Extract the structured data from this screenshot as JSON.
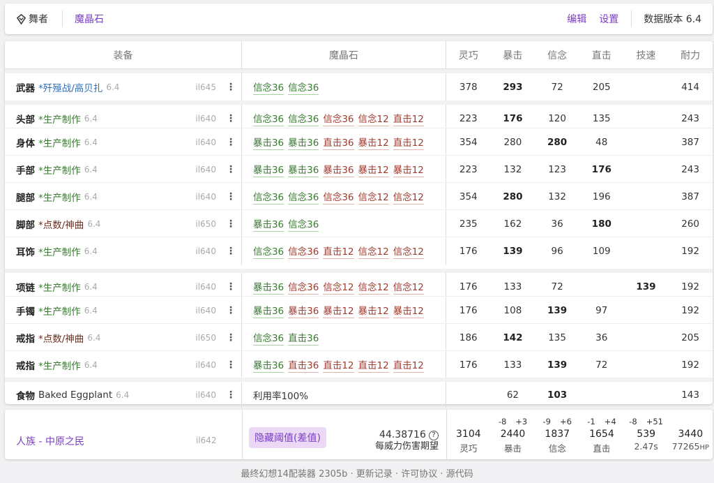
{
  "topbar": {
    "job": "舞者",
    "tab": "魔晶石",
    "edit": "编辑",
    "settings": "设置",
    "version": "数据版本 6.4"
  },
  "table": {
    "headers": {
      "equip": "装备",
      "materia": "魔晶石",
      "stats": [
        "灵巧",
        "暴击",
        "信念",
        "直击",
        "技速",
        "耐力"
      ]
    },
    "rows": [
      {
        "slot": "武器",
        "item": "*歼殛战/高贝扎",
        "type": "raid",
        "patch": "6.4",
        "ilvl": "il645",
        "materia": [
          {
            "t": "信念36",
            "s": "hl"
          },
          {
            "t": "信念36",
            "s": "hl"
          }
        ],
        "stats": [
          "378",
          "293",
          "72",
          "205",
          "",
          "414"
        ],
        "bold": [
          1
        ]
      },
      {
        "slot": "头部",
        "item": "*生产制作",
        "type": "craft",
        "patch": "6.4",
        "ilvl": "il640",
        "materia": [
          {
            "t": "信念36",
            "s": "hl"
          },
          {
            "t": "信念36",
            "s": "hl"
          },
          {
            "t": "信念36",
            "s": "bad"
          },
          {
            "t": "信念12",
            "s": "bad"
          },
          {
            "t": "直击12",
            "s": "bad"
          }
        ],
        "stats": [
          "223",
          "176",
          "120",
          "135",
          "",
          "243"
        ],
        "bold": [
          1
        ]
      },
      {
        "slot": "身体",
        "item": "*生产制作",
        "type": "craft",
        "patch": "6.4",
        "ilvl": "il640",
        "materia": [
          {
            "t": "暴击36",
            "s": "hl"
          },
          {
            "t": "暴击36",
            "s": "hl"
          },
          {
            "t": "直击36",
            "s": "bad"
          },
          {
            "t": "暴击12",
            "s": "bad"
          },
          {
            "t": "直击12",
            "s": "bad"
          }
        ],
        "stats": [
          "354",
          "280",
          "280",
          "48",
          "",
          "387"
        ],
        "bold": [
          2
        ]
      },
      {
        "slot": "手部",
        "item": "*生产制作",
        "type": "craft",
        "patch": "6.4",
        "ilvl": "il640",
        "materia": [
          {
            "t": "暴击36",
            "s": "hl"
          },
          {
            "t": "暴击36",
            "s": "hl"
          },
          {
            "t": "暴击36",
            "s": "bad"
          },
          {
            "t": "暴击12",
            "s": "bad"
          },
          {
            "t": "暴击12",
            "s": "bad"
          }
        ],
        "stats": [
          "223",
          "132",
          "123",
          "176",
          "",
          "243"
        ],
        "bold": [
          3
        ]
      },
      {
        "slot": "腿部",
        "item": "*生产制作",
        "type": "craft",
        "patch": "6.4",
        "ilvl": "il640",
        "materia": [
          {
            "t": "信念36",
            "s": "hl"
          },
          {
            "t": "信念36",
            "s": "hl"
          },
          {
            "t": "信念36",
            "s": "bad"
          },
          {
            "t": "信念12",
            "s": "bad"
          },
          {
            "t": "信念12",
            "s": "bad"
          }
        ],
        "stats": [
          "354",
          "280",
          "132",
          "196",
          "",
          "387"
        ],
        "bold": [
          1
        ]
      },
      {
        "slot": "脚部",
        "item": "*点数/神曲",
        "type": "tome",
        "patch": "6.4",
        "ilvl": "il650",
        "materia": [
          {
            "t": "暴击36",
            "s": "hl"
          },
          {
            "t": "信念36",
            "s": "hl"
          }
        ],
        "stats": [
          "235",
          "162",
          "36",
          "180",
          "",
          "260"
        ],
        "bold": [
          3
        ]
      },
      {
        "slot": "耳饰",
        "item": "*生产制作",
        "type": "craft",
        "patch": "6.4",
        "ilvl": "il640",
        "materia": [
          {
            "t": "信念36",
            "s": "hl"
          },
          {
            "t": "信念36",
            "s": "bad"
          },
          {
            "t": "直击12",
            "s": "bad"
          },
          {
            "t": "信念12",
            "s": "bad"
          },
          {
            "t": "信念12",
            "s": "bad"
          }
        ],
        "stats": [
          "176",
          "139",
          "96",
          "109",
          "",
          "192"
        ],
        "bold": [
          1
        ]
      },
      {
        "slot": "项链",
        "item": "*生产制作",
        "type": "craft",
        "patch": "6.4",
        "ilvl": "il640",
        "materia": [
          {
            "t": "暴击36",
            "s": "hl"
          },
          {
            "t": "信念36",
            "s": "bad"
          },
          {
            "t": "信念12",
            "s": "bad"
          },
          {
            "t": "信念12",
            "s": "bad"
          },
          {
            "t": "信念12",
            "s": "bad"
          }
        ],
        "stats": [
          "176",
          "133",
          "72",
          "",
          "139",
          "192"
        ],
        "bold": [
          4
        ]
      },
      {
        "slot": "手镯",
        "item": "*生产制作",
        "type": "craft",
        "patch": "6.4",
        "ilvl": "il640",
        "materia": [
          {
            "t": "暴击36",
            "s": "hl"
          },
          {
            "t": "暴击36",
            "s": "bad"
          },
          {
            "t": "暴击12",
            "s": "bad"
          },
          {
            "t": "暴击12",
            "s": "bad"
          },
          {
            "t": "暴击12",
            "s": "bad"
          }
        ],
        "stats": [
          "176",
          "108",
          "139",
          "97",
          "",
          "192"
        ],
        "bold": [
          2
        ]
      },
      {
        "slot": "戒指",
        "item": "*点数/神曲",
        "type": "tome",
        "patch": "6.4",
        "ilvl": "il650",
        "materia": [
          {
            "t": "信念36",
            "s": "hl"
          },
          {
            "t": "直击36",
            "s": "hl"
          }
        ],
        "stats": [
          "186",
          "142",
          "135",
          "36",
          "",
          "205"
        ],
        "bold": [
          1
        ]
      },
      {
        "slot": "戒指",
        "item": "*生产制作",
        "type": "craft",
        "patch": "6.4",
        "ilvl": "il640",
        "materia": [
          {
            "t": "暴击36",
            "s": "hl"
          },
          {
            "t": "直击36",
            "s": "bad"
          },
          {
            "t": "直击12",
            "s": "bad"
          },
          {
            "t": "直击12",
            "s": "bad"
          },
          {
            "t": "直击12",
            "s": "bad"
          }
        ],
        "stats": [
          "176",
          "133",
          "139",
          "72",
          "",
          "192"
        ],
        "bold": [
          2
        ]
      },
      {
        "slot": "食物",
        "item": "Baked Eggplant",
        "type": "food",
        "patch": "6.4",
        "ilvl": "il640",
        "materia": [
          {
            "t": "利用率100%",
            "s": "plain"
          }
        ],
        "stats": [
          "",
          "62",
          "103",
          "",
          "",
          "143"
        ],
        "bold": [
          2
        ]
      }
    ]
  },
  "summary": {
    "race": "人族 - 中原之民",
    "ilvl": "il642",
    "badge": "隐藏阈值(差值)",
    "expect_value": "44.38716",
    "expect_label": "每威力伤害期望",
    "help_icon": "question-circle-icon",
    "stats": [
      {
        "value": "3104",
        "label": "灵巧",
        "adj": []
      },
      {
        "value": "2440",
        "label": "暴击",
        "adj": [
          "-8",
          "+3"
        ]
      },
      {
        "value": "1837",
        "label": "信念",
        "adj": [
          "-9",
          "+6"
        ]
      },
      {
        "value": "1654",
        "label": "直击",
        "adj": [
          "-1",
          "+4"
        ]
      },
      {
        "value": "539",
        "label": "2.47s",
        "adj": [
          "-8",
          "+51"
        ]
      },
      {
        "value": "3440",
        "label": "77265",
        "label_unit": "HP",
        "adj": []
      }
    ]
  },
  "footer": "最终幻想14配装器 2305b · 更新记录 · 许可协议 · 源代码",
  "colors": {
    "accent": "#7b3fc4",
    "highlight": "#3a7a32",
    "overcap": "#9d3b2f"
  }
}
